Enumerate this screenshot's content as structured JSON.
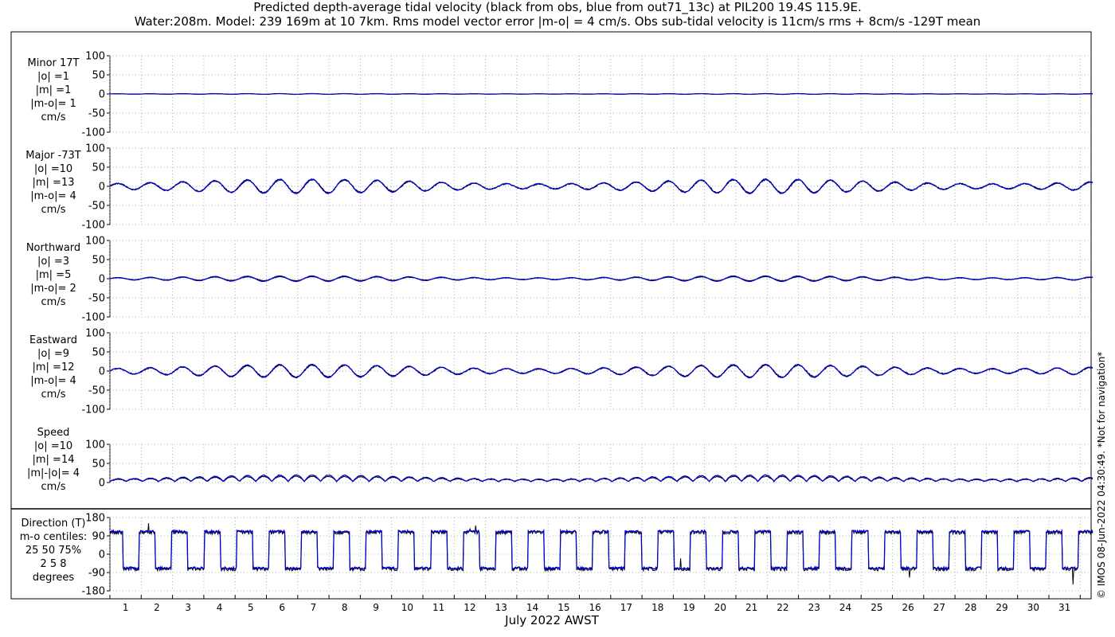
{
  "title": {
    "line1": "Predicted depth-average tidal velocity (black from obs, blue from out71_13c) at PIL200 19.4S 115.9E.",
    "line2": "Water:208m. Model: 239 169m at 10 7km. Rms model vector error |m-o| = 4 cm/s. Obs sub-tidal velocity is 11cm/s rms + 8cm/s -129T mean"
  },
  "side_note": "© IMOS 08-Jun-2022 04:30:49. *Not for navigation*",
  "colors": {
    "obs": "#000000",
    "model": "#0000cc",
    "grid": "#999999",
    "axis": "#000000"
  },
  "chart_data": {
    "type": "line",
    "xlabel": "July 2022 AWST",
    "x_ticks": [
      "1",
      "2",
      "3",
      "4",
      "5",
      "6",
      "7",
      "8",
      "9",
      "10",
      "11",
      "12",
      "13",
      "14",
      "15",
      "16",
      "17",
      "18",
      "19",
      "20",
      "21",
      "22",
      "23",
      "24",
      "25",
      "26",
      "27",
      "28",
      "29",
      "30",
      "31"
    ],
    "xlim_days": [
      0,
      31.4
    ],
    "series_legend": {
      "obs": "black from obs",
      "model": "blue from out71_13c"
    },
    "panels": [
      {
        "id": "minor",
        "label_lines": [
          "Minor 17T",
          "|o| =1",
          "|m| =1",
          "|m-o|= 1",
          "cm/s"
        ],
        "ylim": [
          -100,
          100
        ],
        "yticks": [
          "100",
          "50",
          "0",
          "-50",
          "-100"
        ],
        "ytick_values": [
          100,
          50,
          0,
          -50,
          -100
        ],
        "obs_amplitude": 1,
        "model_amplitude": 1
      },
      {
        "id": "major",
        "label_lines": [
          "Major -73T",
          "|o| =10",
          "|m| =13",
          "|m-o|= 4",
          "cm/s"
        ],
        "ylim": [
          -100,
          100
        ],
        "yticks": [
          "100",
          "50",
          "0",
          "-50",
          "-100"
        ],
        "ytick_values": [
          100,
          50,
          0,
          -50,
          -100
        ],
        "obs_amplitude": 10,
        "model_amplitude": 13
      },
      {
        "id": "northward",
        "label_lines": [
          "Northward",
          "|o| =3",
          "|m| =5",
          "|m-o|= 2",
          "cm/s"
        ],
        "ylim": [
          -100,
          100
        ],
        "yticks": [
          "100",
          "50",
          "0",
          "-50",
          "-100"
        ],
        "ytick_values": [
          100,
          50,
          0,
          -50,
          -100
        ],
        "obs_amplitude": 3,
        "model_amplitude": 5
      },
      {
        "id": "eastward",
        "label_lines": [
          "Eastward",
          "|o| =9",
          "|m| =12",
          "|m-o|= 4",
          "cm/s"
        ],
        "ylim": [
          -100,
          100
        ],
        "yticks": [
          "100",
          "50",
          "0",
          "-50",
          "-100"
        ],
        "ytick_values": [
          100,
          50,
          0,
          -50,
          -100
        ],
        "obs_amplitude": 9,
        "model_amplitude": 12
      },
      {
        "id": "speed",
        "label_lines": [
          "Speed",
          "|o| =10",
          "|m| =14",
          "|m|-|o|= 4",
          "cm/s"
        ],
        "ylim": [
          0,
          100
        ],
        "yticks": [
          "100",
          "50",
          "0"
        ],
        "ytick_values": [
          100,
          50,
          0
        ],
        "obs_amplitude": 10,
        "model_amplitude": 14
      },
      {
        "id": "direction",
        "label_lines": [
          "Direction (T)",
          "m-o centiles:",
          "25  50  75%",
          "2  5  8",
          "degrees"
        ],
        "ylim": [
          -180,
          180
        ],
        "yticks": [
          "180",
          "90",
          "0",
          "-90",
          "-180"
        ],
        "ytick_values": [
          180,
          90,
          0,
          -90,
          -180
        ],
        "centiles": {
          "p25": 2,
          "p50": 5,
          "p75": 8
        }
      }
    ]
  }
}
